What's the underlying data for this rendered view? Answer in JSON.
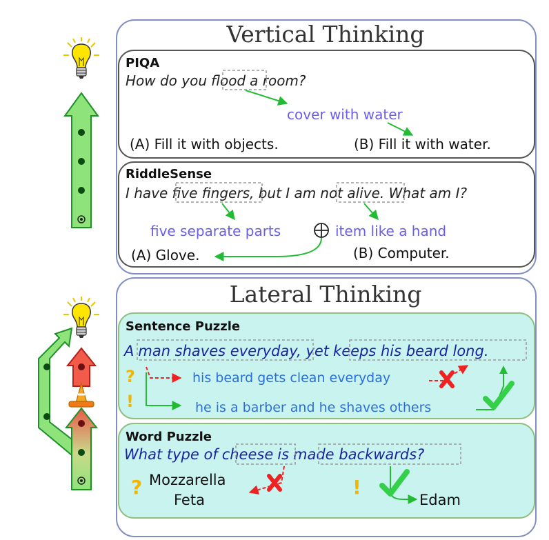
{
  "vertical": {
    "title": "Vertical Thinking",
    "piqa": {
      "label": "PIQA",
      "question_before": "How do you",
      "question_highlight": "flood",
      "question_after": "a room?",
      "hint": "cover with water",
      "option_a": "(A) Fill it with objects.",
      "option_b": "(B) Fill it with water."
    },
    "riddlesense": {
      "label": "RiddleSense",
      "q_part1": "I have",
      "q_highlight1": "five fingers",
      "q_part2": ", but I am",
      "q_highlight2": "not alive",
      "q_part3": ". What am I?",
      "hint_left": "five separate parts",
      "hint_right": "item like a hand",
      "option_a": "(A) Glove.",
      "option_b": "(B) Computer."
    }
  },
  "lateral": {
    "title": "Lateral Thinking",
    "sentence_puzzle": {
      "label": "Sentence Puzzle",
      "s_part1": "A",
      "s_highlight1": "man shaves everyday",
      "s_part2": ", yet",
      "s_highlight2": "keeps his beard long.",
      "wrong_line": "his beard gets clean everyday",
      "right_line": "he is a barber and he shaves others",
      "question_mark": "?",
      "exclaim_mark": "!"
    },
    "word_puzzle": {
      "label": "Word Puzzle",
      "q_part1": "What type of",
      "q_highlight1": "cheese",
      "q_part2": "is",
      "q_highlight2": "made backwards?",
      "wrong_answer_1": "Mozzarella",
      "wrong_answer_2": "Feta",
      "right_answer": "Edam",
      "question_mark": "?",
      "exclaim_mark": "!"
    }
  },
  "colors": {
    "panel_border": "#7f8fc0",
    "card_border": "#555555",
    "lateral_card_fill": "#c9f3ef",
    "lateral_card_border": "#8fbf7f",
    "hint_text": "#6a5ee8",
    "lateral_text": "#1a23a0",
    "answer_blue": "#2a6fd8",
    "arrow_green": "#22bb33",
    "arrow_red": "#ee2222",
    "bulb_yellow": "#ffe600"
  }
}
